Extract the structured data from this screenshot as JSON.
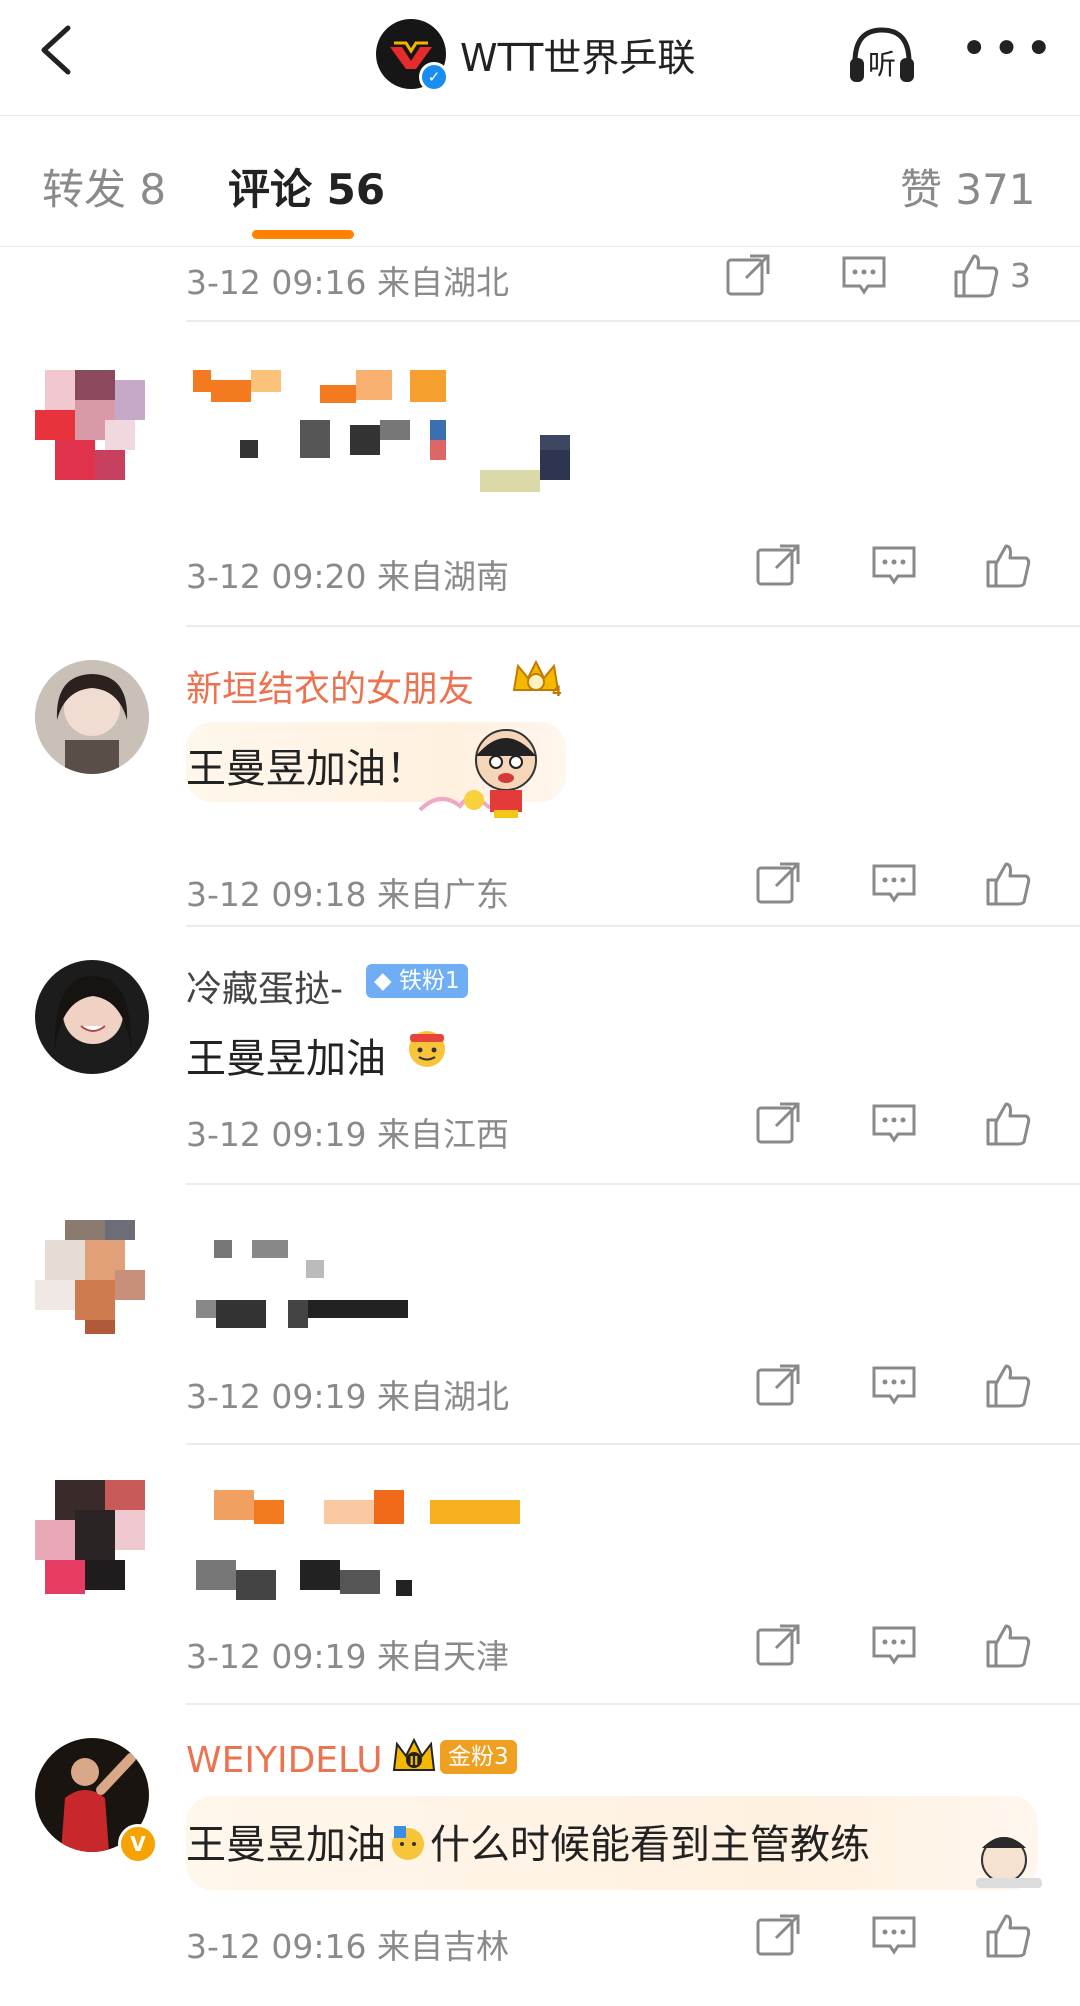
{
  "header": {
    "title": "WTT世界乒联",
    "listen_label": "听"
  },
  "tabs": {
    "repost": "转发 8",
    "comments": "评论 56",
    "likes": "赞 371"
  },
  "top_partial": {
    "meta": "3-12 09:16  来自湖北",
    "like_count": "3"
  },
  "comments": [
    {
      "meta": "3-12 09:20  来自湖南"
    },
    {
      "username": "新垣结衣的女朋友",
      "text": "王曼昱加油！",
      "meta": "3-12 09:18  来自广东"
    },
    {
      "username": "冷藏蛋挞-",
      "fan_badge": "铁粉1",
      "text": "王曼昱加油",
      "meta": "3-12 09:19  来自江西"
    },
    {
      "meta": "3-12 09:19  来自湖北"
    },
    {
      "meta": "3-12 09:19  来自天津"
    },
    {
      "username": "WEIYIDELU",
      "fan_badge": "金粉3",
      "text_a": "王曼昱加油",
      "text_b": "什么时候能看到主管教练",
      "meta": "3-12 09:16  来自吉林"
    }
  ],
  "colors": {
    "accent": "#ff8200",
    "vip_name": "#eb7350",
    "meta": "#8a8a8a"
  },
  "icons": [
    "back-arrow-icon",
    "headphones-icon",
    "more-dots-icon",
    "repost-icon",
    "comment-icon",
    "thumb-up-icon",
    "verified-icon",
    "crown-icon",
    "diamond-icon"
  ]
}
